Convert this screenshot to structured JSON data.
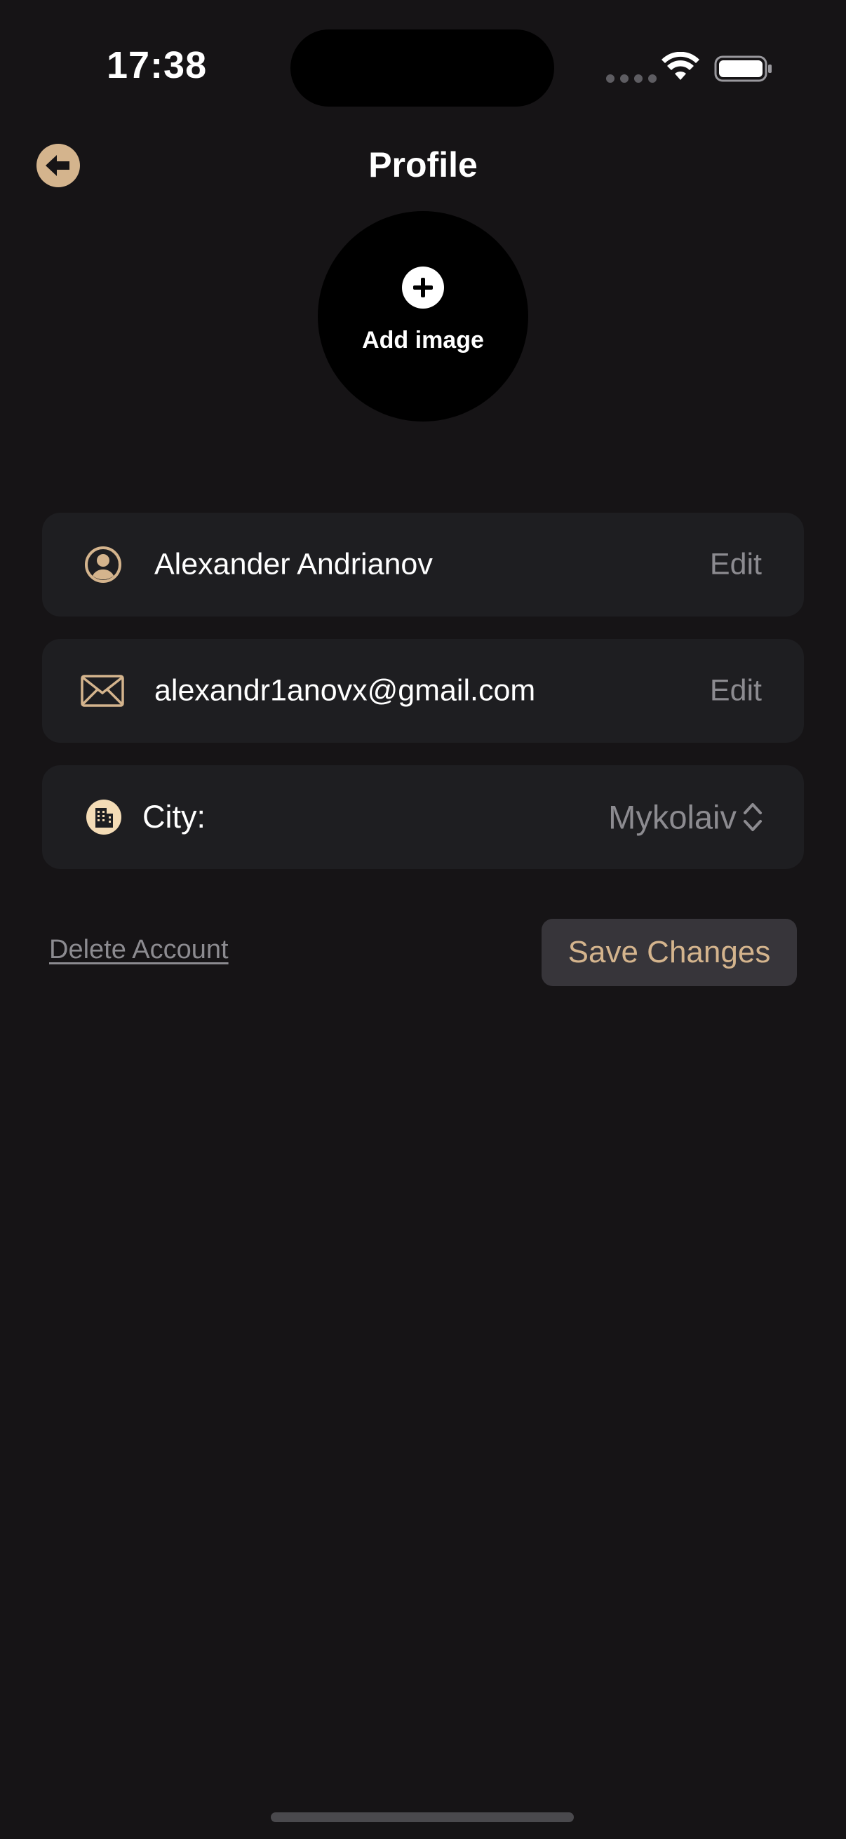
{
  "status_bar": {
    "time": "17:38"
  },
  "header": {
    "title": "Profile",
    "back_icon": "arrow-left-circle-icon"
  },
  "avatar": {
    "label": "Add image",
    "icon": "plus-circle-icon"
  },
  "fields": {
    "name": {
      "value": "Alexander Andrianov",
      "edit_label": "Edit",
      "icon": "person-circle-icon"
    },
    "email": {
      "value": "alexandr1anovx@gmail.com",
      "edit_label": "Edit",
      "icon": "envelope-icon"
    },
    "city": {
      "label": "City:",
      "value": "Mykolaiv",
      "icon": "building-icon"
    }
  },
  "actions": {
    "delete_label": "Delete Account",
    "save_label": "Save Changes"
  },
  "colors": {
    "background": "#161416",
    "card": "#1e1e21",
    "accent": "#d4b48d",
    "secondary_text": "#8c8b90",
    "button_bg": "#37353a"
  }
}
